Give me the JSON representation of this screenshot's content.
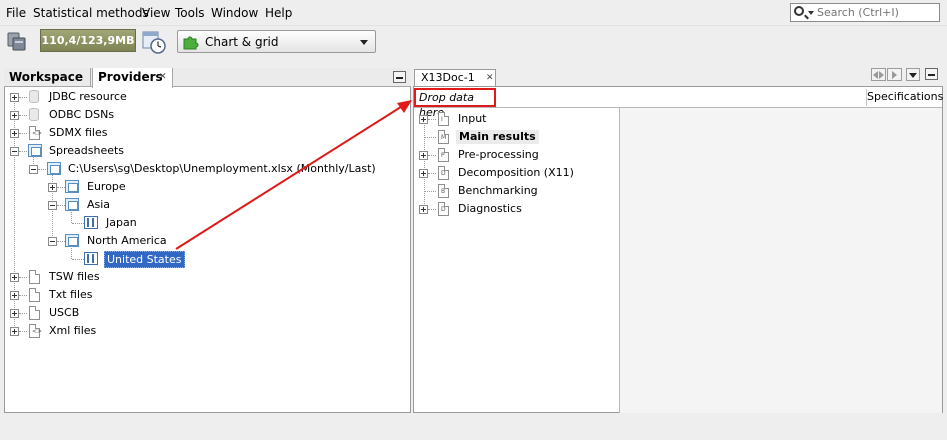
{
  "menubar": {
    "items": [
      "File",
      "Statistical methods",
      "View",
      "Tools",
      "Window",
      "Help"
    ]
  },
  "search": {
    "placeholder": "Search (Ctrl+I)"
  },
  "toolbar": {
    "memory": "110,4/123,9MB",
    "workspace_combo": "Chart & grid"
  },
  "left_panel": {
    "tabs": [
      "Workspace",
      "Providers"
    ],
    "active_tab": "Providers"
  },
  "providers_tree": {
    "jdbc": "JDBC resource",
    "odbc": "ODBC DSNs",
    "sdmx": "SDMX files",
    "spreadsheets": "Spreadsheets",
    "file_path": "C:\\Users\\sg\\Desktop\\Unemployment.xlsx (Monthly/Last)",
    "europe": "Europe",
    "asia": "Asia",
    "japan": "Japan",
    "north_america": "North America",
    "united_states": "United States",
    "tsw": "TSW files",
    "txt": "Txt files",
    "uscb": "USCB",
    "xml": "Xml files"
  },
  "document": {
    "tab": "X13Doc-1",
    "drop_hint": "Drop data here",
    "specifications": "Specifications",
    "nodes": [
      "Input",
      "Main results",
      "Pre-processing",
      "Decomposition (X11)",
      "Benchmarking",
      "Diagnostics"
    ],
    "node_letters": [
      "I",
      "M",
      "P",
      "D",
      "B",
      "D"
    ]
  },
  "colors": {
    "selection": "#3168c5",
    "annotation_red": "#e01919",
    "memory_bar": "#8f9463"
  }
}
